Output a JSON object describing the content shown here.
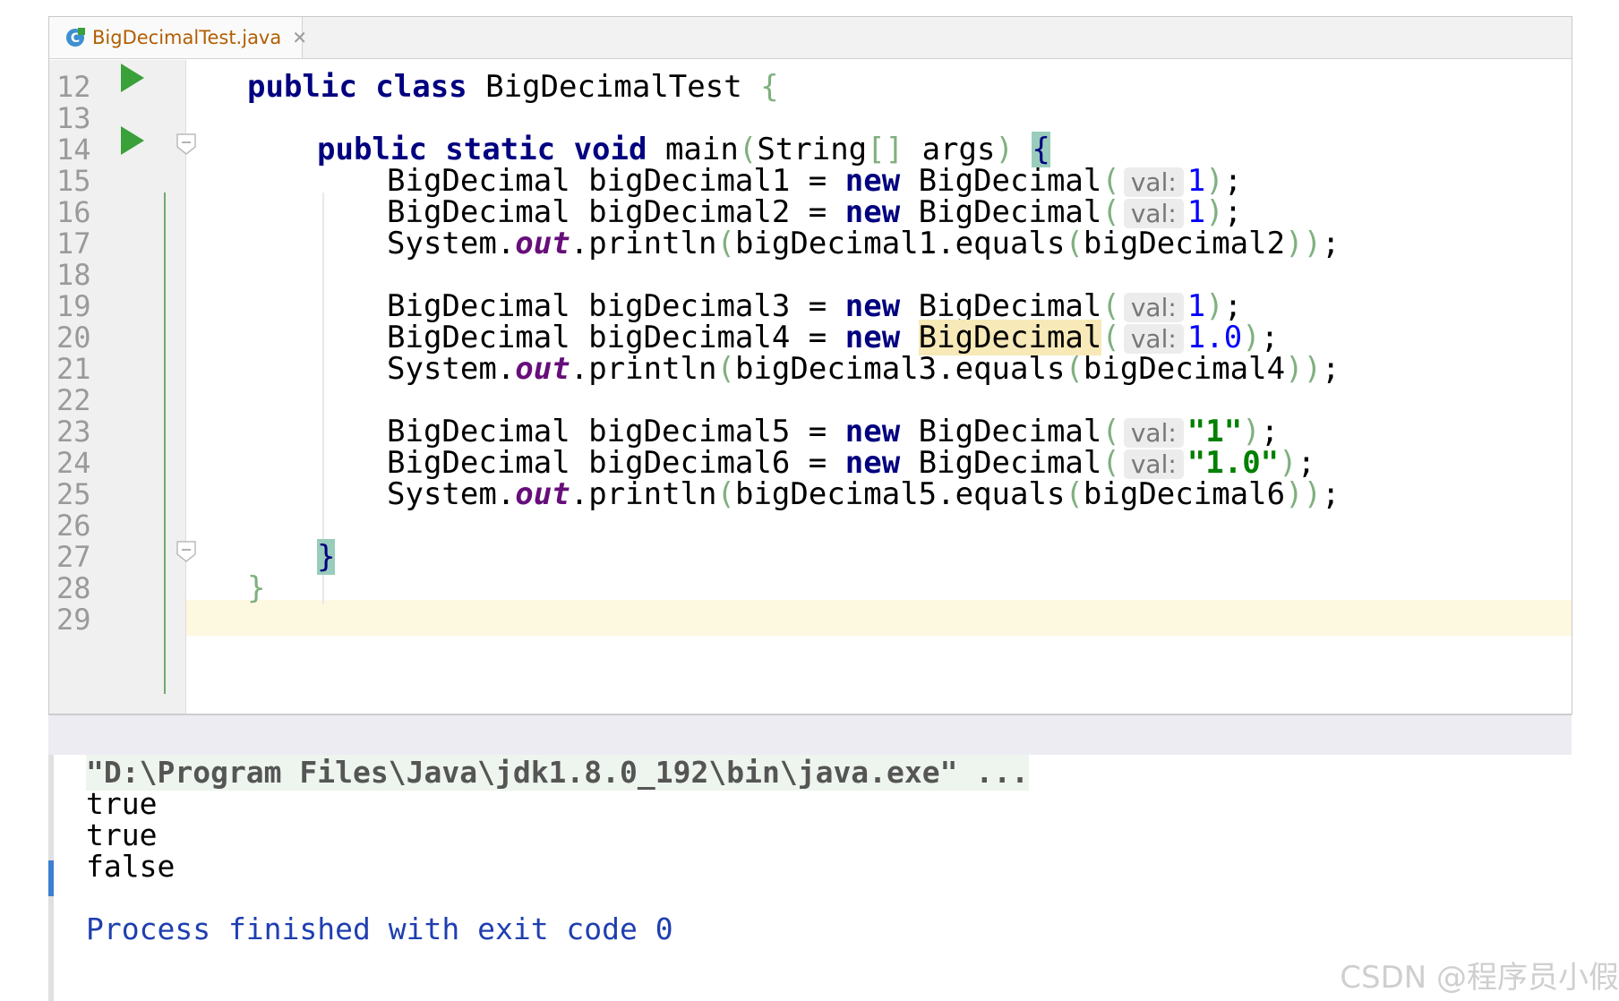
{
  "tab": {
    "filename": "BigDecimalTest.java",
    "close": "✕",
    "icon": "java-class-icon"
  },
  "gutter": {
    "line_numbers": [
      "12",
      "13",
      "14",
      "15",
      "16",
      "17",
      "18",
      "19",
      "20",
      "21",
      "22",
      "23",
      "24",
      "25",
      "26",
      "27",
      "28",
      "29"
    ]
  },
  "code": {
    "l12": {
      "kw": "public class",
      "name": " BigDecimalTest ",
      "brace": "{"
    },
    "l14": {
      "kw": "public static void",
      "sig": " main",
      "p1": "(",
      "args": "String",
      "arr": "[]",
      "argn": " args",
      "p2": ")",
      "brace": "{"
    },
    "type": "BigDecimal",
    "newkw": "new",
    "hint": "val:",
    "sys": "System.",
    "out": "out",
    "println": ".println",
    "decls": [
      {
        "var": " bigDecimal1 = ",
        "arg": "1",
        "kind": "num"
      },
      {
        "var": " bigDecimal2 = ",
        "arg": "1",
        "kind": "num"
      },
      {
        "var": " bigDecimal3 = ",
        "arg": "1",
        "kind": "num"
      },
      {
        "var": " bigDecimal4 = ",
        "arg": "1.0",
        "kind": "num"
      },
      {
        "var": " bigDecimal5 = ",
        "arg": "\"1\"",
        "kind": "str"
      },
      {
        "var": " bigDecimal6 = ",
        "arg": "\"1.0\"",
        "kind": "str"
      }
    ],
    "prints": [
      {
        "a": "bigDecimal1",
        "b": "bigDecimal2"
      },
      {
        "a": "bigDecimal3",
        "b": "bigDecimal4"
      },
      {
        "a": "bigDecimal5",
        "b": "bigDecimal6"
      }
    ],
    "equals": ".equals",
    "close_method": "}",
    "close_class": "}"
  },
  "console": {
    "command": "\"D:\\Program Files\\Java\\jdk1.8.0_192\\bin\\java.exe\" ...",
    "outputs": [
      "true",
      "true",
      "false"
    ],
    "exit": "Process finished with exit code 0"
  },
  "watermark": "CSDN @程序员小假"
}
